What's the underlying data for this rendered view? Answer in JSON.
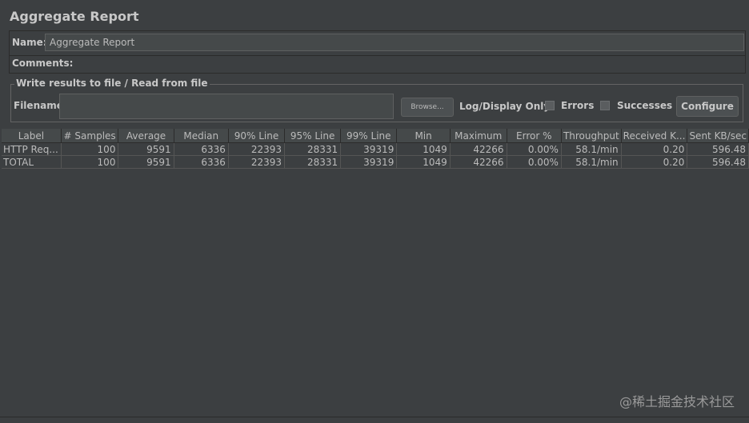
{
  "panel": {
    "title": "Aggregate Report",
    "name_label": "Name:",
    "name_value": "Aggregate Report",
    "comments_label": "Comments:"
  },
  "file_section": {
    "legend": "Write results to file / Read from file",
    "filename_label": "Filename",
    "filename_value": "",
    "browse_label": "Browse...",
    "log_display_label": "Log/Display Only:",
    "errors_label": "Errors",
    "errors_checked": false,
    "successes_label": "Successes",
    "successes_checked": false,
    "configure_label": "Configure"
  },
  "table": {
    "columns": [
      "Label",
      "# Samples",
      "Average",
      "Median",
      "90% Line",
      "95% Line",
      "99% Line",
      "Min",
      "Maximum",
      "Error %",
      "Throughput",
      "Received K...",
      "Sent KB/sec"
    ],
    "rows": [
      [
        "HTTP Req...",
        "100",
        "9591",
        "6336",
        "22393",
        "28331",
        "39319",
        "1049",
        "42266",
        "0.00%",
        "58.1/min",
        "0.20",
        "596.48"
      ],
      [
        "TOTAL",
        "100",
        "9591",
        "6336",
        "22393",
        "28331",
        "39319",
        "1049",
        "42266",
        "0.00%",
        "58.1/min",
        "0.20",
        "596.48"
      ]
    ]
  },
  "watermark": "@稀土掘金技术社区"
}
